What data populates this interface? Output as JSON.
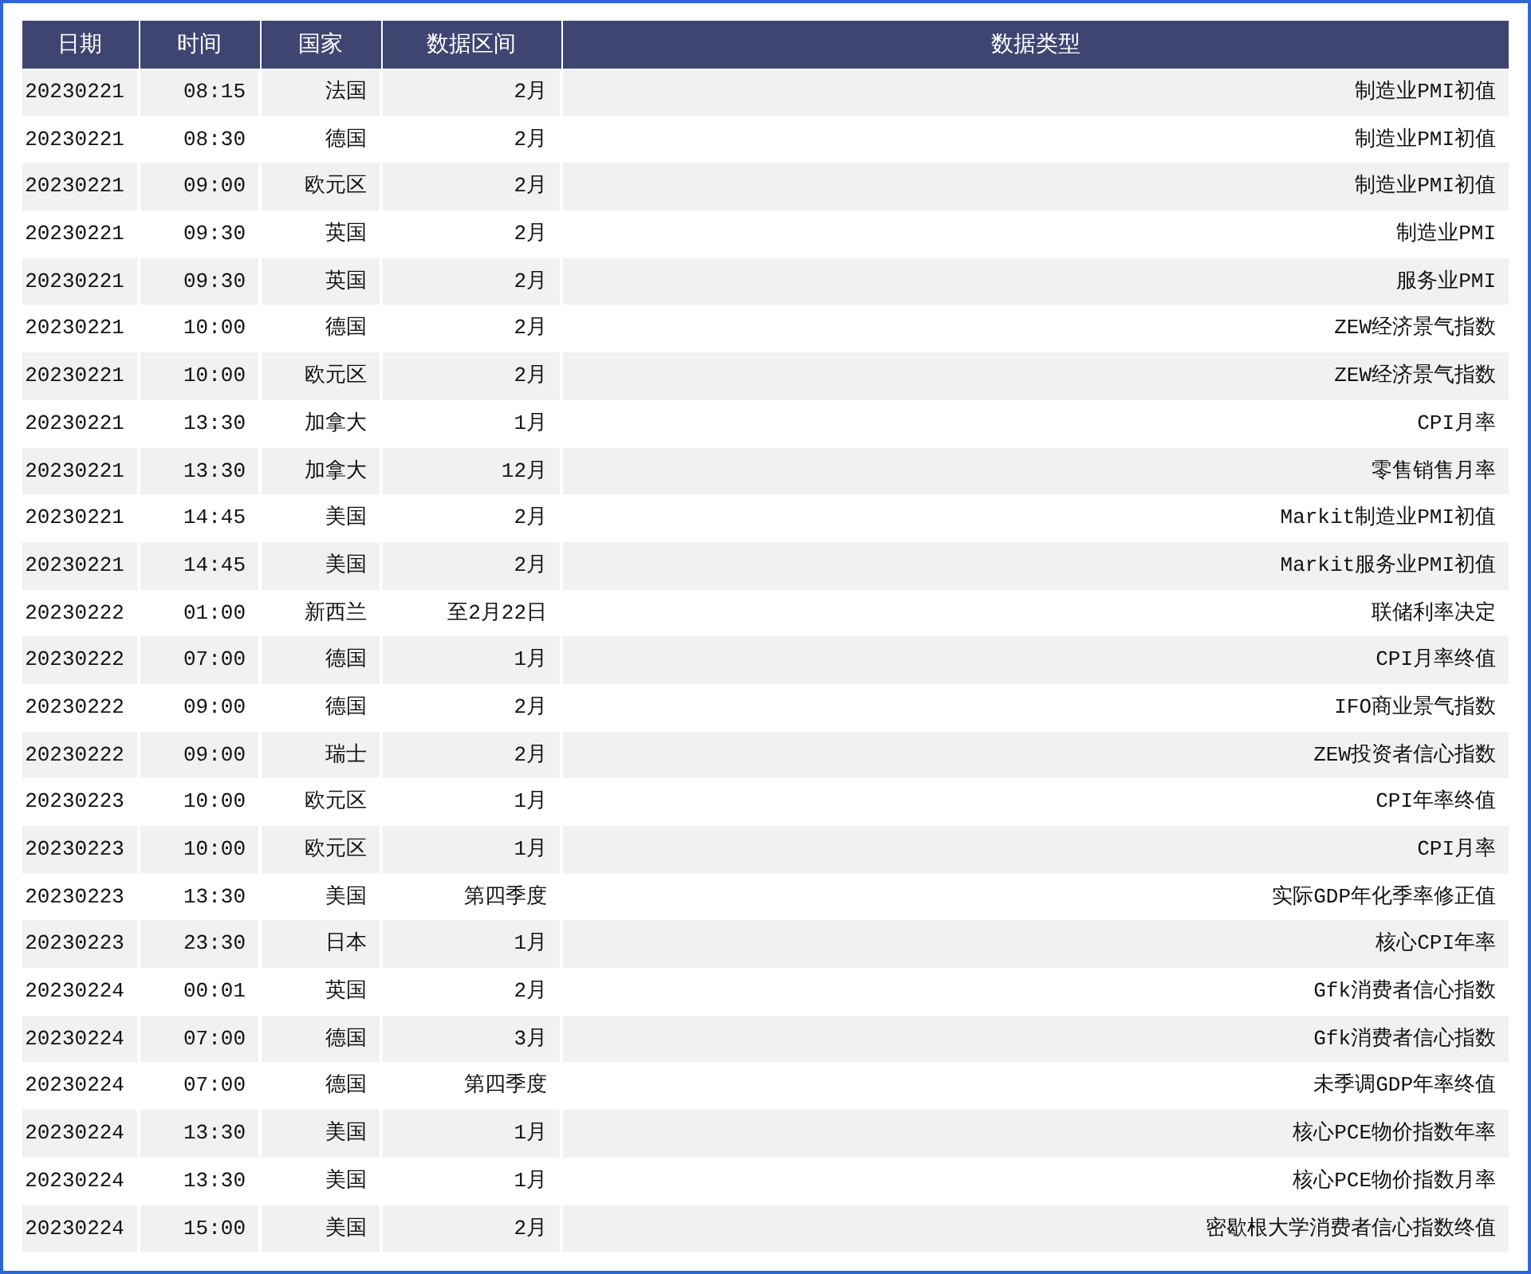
{
  "table": {
    "columns": [
      "日期",
      "时间",
      "国家",
      "数据区间",
      "数据类型"
    ],
    "rows": [
      [
        "20230221",
        "08:15",
        "法国",
        "2月",
        "制造业PMI初值"
      ],
      [
        "20230221",
        "08:30",
        "德国",
        "2月",
        "制造业PMI初值"
      ],
      [
        "20230221",
        "09:00",
        "欧元区",
        "2月",
        "制造业PMI初值"
      ],
      [
        "20230221",
        "09:30",
        "英国",
        "2月",
        "制造业PMI"
      ],
      [
        "20230221",
        "09:30",
        "英国",
        "2月",
        "服务业PMI"
      ],
      [
        "20230221",
        "10:00",
        "德国",
        "2月",
        "ZEW经济景气指数"
      ],
      [
        "20230221",
        "10:00",
        "欧元区",
        "2月",
        "ZEW经济景气指数"
      ],
      [
        "20230221",
        "13:30",
        "加拿大",
        "1月",
        "CPI月率"
      ],
      [
        "20230221",
        "13:30",
        "加拿大",
        "12月",
        "零售销售月率"
      ],
      [
        "20230221",
        "14:45",
        "美国",
        "2月",
        "Markit制造业PMI初值"
      ],
      [
        "20230221",
        "14:45",
        "美国",
        "2月",
        "Markit服务业PMI初值"
      ],
      [
        "20230222",
        "01:00",
        "新西兰",
        "至2月22日",
        "联储利率决定"
      ],
      [
        "20230222",
        "07:00",
        "德国",
        "1月",
        "CPI月率终值"
      ],
      [
        "20230222",
        "09:00",
        "德国",
        "2月",
        "IFO商业景气指数"
      ],
      [
        "20230222",
        "09:00",
        "瑞士",
        "2月",
        "ZEW投资者信心指数"
      ],
      [
        "20230223",
        "10:00",
        "欧元区",
        "1月",
        "CPI年率终值"
      ],
      [
        "20230223",
        "10:00",
        "欧元区",
        "1月",
        "CPI月率"
      ],
      [
        "20230223",
        "13:30",
        "美国",
        "第四季度",
        "实际GDP年化季率修正值"
      ],
      [
        "20230223",
        "23:30",
        "日本",
        "1月",
        "核心CPI年率"
      ],
      [
        "20230224",
        "00:01",
        "英国",
        "2月",
        "Gfk消费者信心指数"
      ],
      [
        "20230224",
        "07:00",
        "德国",
        "3月",
        "Gfk消费者信心指数"
      ],
      [
        "20230224",
        "07:00",
        "德国",
        "第四季度",
        "未季调GDP年率终值"
      ],
      [
        "20230224",
        "13:30",
        "美国",
        "1月",
        "核心PCE物价指数年率"
      ],
      [
        "20230224",
        "13:30",
        "美国",
        "1月",
        "核心PCE物价指数月率"
      ],
      [
        "20230224",
        "15:00",
        "美国",
        "2月",
        "密歇根大学消费者信心指数终值"
      ]
    ]
  }
}
